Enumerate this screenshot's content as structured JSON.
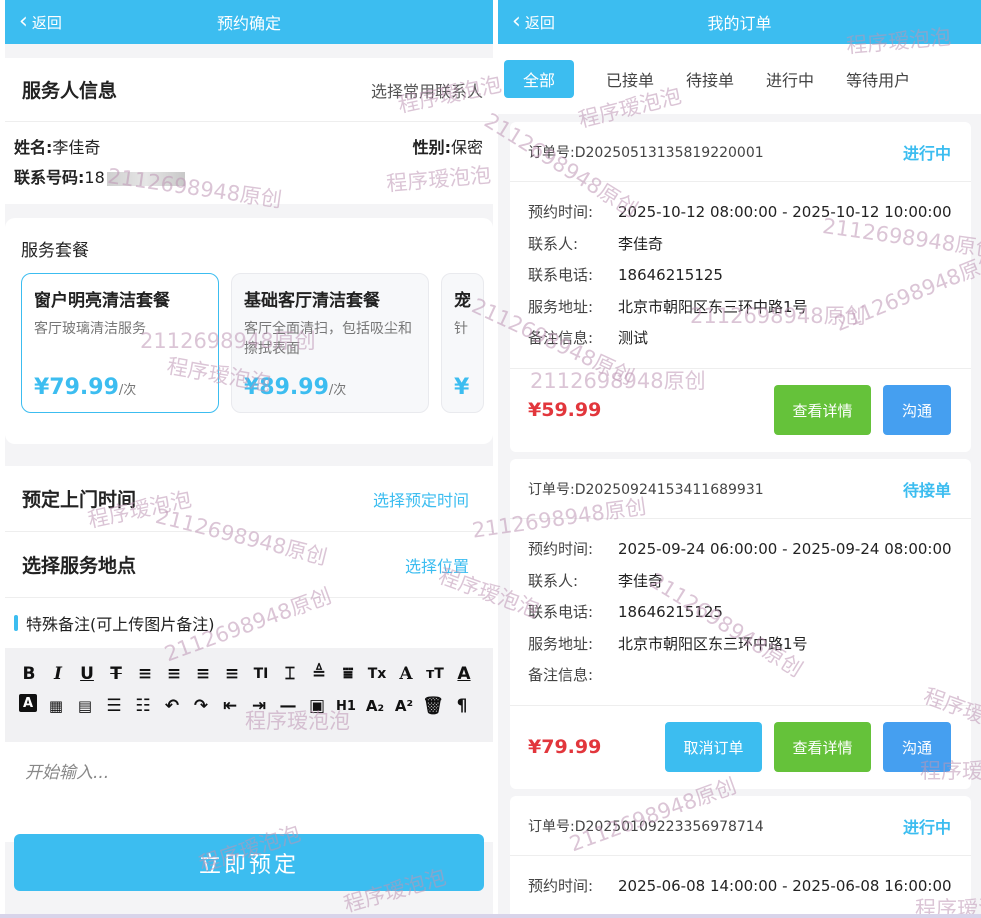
{
  "left": {
    "nav": {
      "back": "返回",
      "title": "预约确定"
    },
    "server_info": {
      "title": "服务人信息",
      "choose_contact": "选择常用联系人",
      "name_label": "姓名:",
      "name": "李佳奇",
      "gender_label": "性别:",
      "gender": "保密",
      "phone_label": "联系号码:",
      "phone_prefix": "18"
    },
    "packages": {
      "title": "服务套餐",
      "items": [
        {
          "name": "窗户明亮清洁套餐",
          "desc": "客厅玻璃清洁服务",
          "price": "¥79.99",
          "unit": "/次"
        },
        {
          "name": "基础客厅清洁套餐",
          "desc": "客厅全面清扫，包括吸尘和擦拭表面",
          "price": "¥89.99",
          "unit": "/次"
        },
        {
          "name": "宠",
          "desc": "针",
          "price": "¥",
          "unit": ""
        }
      ]
    },
    "time": {
      "label": "预定上门时间",
      "action": "选择预定时间"
    },
    "location": {
      "label": "选择服务地点",
      "action": "选择位置"
    },
    "remark": {
      "title": "特殊备注(可上传图片备注)",
      "placeholder": "开始输入..."
    },
    "submit": "立即预定"
  },
  "right": {
    "nav": {
      "back": "返回",
      "title": "我的订单"
    },
    "tabs": [
      "全部",
      "已接单",
      "待接单",
      "进行中",
      "等待用户"
    ],
    "labels": {
      "order_no": "订单号:",
      "time": "预约时间:",
      "contact": "联系人:",
      "phone": "联系电话:",
      "address": "服务地址:",
      "note": "备注信息:",
      "cancel": "取消订单",
      "detail": "查看详情",
      "chat": "沟通"
    },
    "orders": [
      {
        "no": "D20250513135819220001",
        "status": "进行中",
        "time": "2025-10-12 08:00:00 - 2025-10-12 10:00:00",
        "contact": "李佳奇",
        "phone": "18646215125",
        "address": "北京市朝阳区东三环中路1号",
        "note": "测试",
        "price": "¥59.99"
      },
      {
        "no": "D20250924153411689931",
        "status": "待接单",
        "time": "2025-09-24 06:00:00 - 2025-09-24 08:00:00",
        "contact": "李佳奇",
        "phone": "18646215125",
        "address": "北京市朝阳区东三环中路1号",
        "note": "",
        "price": "¥79.99"
      },
      {
        "no": "D20250109223356978714",
        "status": "进行中",
        "time": "2025-06-08 14:00:00 - 2025-06-08 16:00:00"
      }
    ]
  },
  "watermarks": {
    "qq": "2112698948原创",
    "brand": "程序瑷泡泡"
  }
}
